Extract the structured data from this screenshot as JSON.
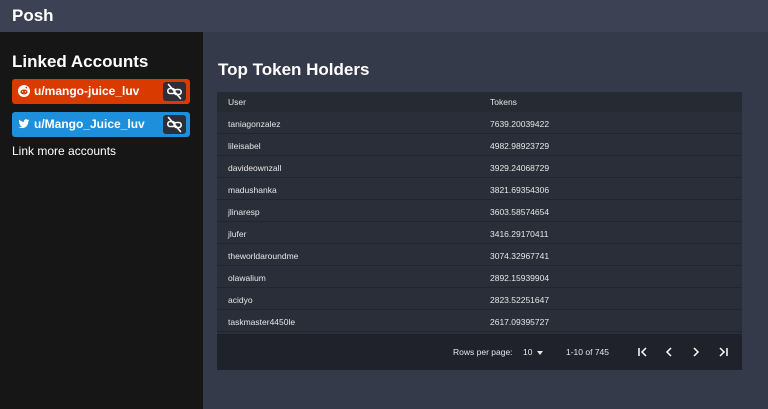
{
  "app": {
    "title": "Posh"
  },
  "sidebar": {
    "title": "Linked Accounts",
    "accounts": [
      {
        "platform": "reddit",
        "name": "u/mango-juice_luv",
        "color": "#d93a00",
        "icon": "reddit-icon",
        "action_icon": "unlink-icon"
      },
      {
        "platform": "twitter",
        "name": "u/Mango_Juice_luv",
        "color": "#1d8fdb",
        "icon": "twitter-icon",
        "action_icon": "unlink-icon"
      }
    ],
    "link_more": "Link more accounts"
  },
  "main": {
    "title": "Top Token Holders",
    "table": {
      "columns": [
        "User",
        "Tokens"
      ],
      "rows": [
        {
          "user": "taniagonzalez",
          "tokens": "7639.20039422"
        },
        {
          "user": "lileisabel",
          "tokens": "4982.98923729"
        },
        {
          "user": "davideownzall",
          "tokens": "3929.24068729"
        },
        {
          "user": "madushanka",
          "tokens": "3821.69354306"
        },
        {
          "user": "jlinaresp",
          "tokens": "3603.58574654"
        },
        {
          "user": "jlufer",
          "tokens": "3416.29170411"
        },
        {
          "user": "theworldaroundme",
          "tokens": "3074.32967741"
        },
        {
          "user": "olawalium",
          "tokens": "2892.15939904"
        },
        {
          "user": "acidyo",
          "tokens": "2823.52251647"
        },
        {
          "user": "taskmaster4450le",
          "tokens": "2617.09395727"
        }
      ]
    },
    "pagination": {
      "rows_per_page_label": "Rows per page:",
      "rows_per_page_value": "10",
      "range": "1-10 of 745",
      "icons": [
        "first-page-icon",
        "prev-page-icon",
        "next-page-icon",
        "last-page-icon"
      ]
    }
  },
  "colors": {
    "topbar": "#3c4253",
    "sidebar": "#161616",
    "reddit": "#d93a00",
    "twitter": "#1d8fdb",
    "table_bg": "#2a2e38"
  }
}
